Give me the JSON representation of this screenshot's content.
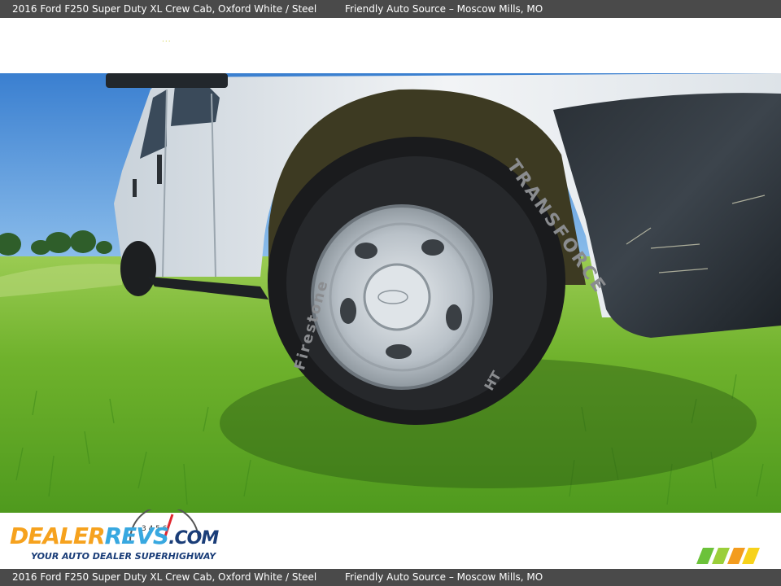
{
  "header": {
    "vehicle": "2016 Ford F250 Super Duty XL Crew Cab,",
    "color": "Oxford White / Steel",
    "dealer": "Friendly Auto Source – Moscow Mills, MO"
  },
  "footer": {
    "vehicle": "2016 Ford F250 Super Duty XL Crew Cab,",
    "color": "Oxford White / Steel",
    "dealer": "Friendly Auto Source – Moscow Mills, MO"
  },
  "logo": {
    "part1": "DEALER",
    "part2": "REVS",
    "part3": ".COM",
    "tagline": "YOUR AUTO DEALER SUPERHIGHWAY"
  },
  "gauge_digits": "3  4  5  6",
  "tire": {
    "brand": "TRANSFORCE",
    "maker": "Firestone",
    "suffix": "HT"
  },
  "colors": {
    "bar_bg": "#4a4a4a",
    "logo_orange": "#f6a21e",
    "logo_blue": "#38a8e0",
    "logo_navy": "#1a3d78"
  }
}
